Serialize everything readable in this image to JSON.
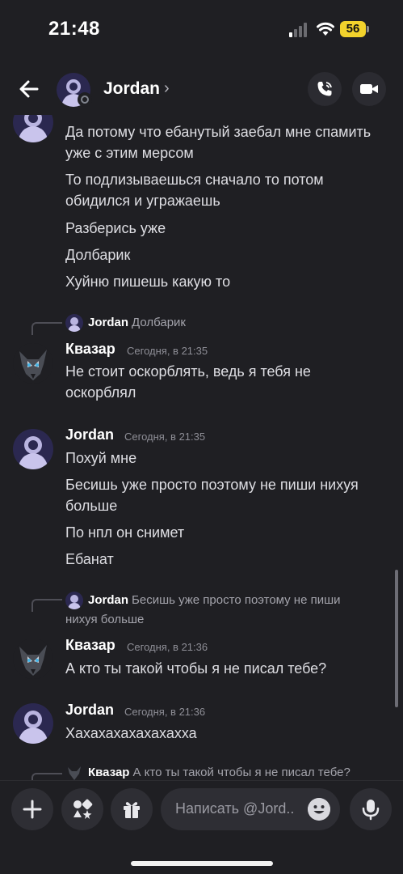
{
  "status_bar": {
    "time": "21:48",
    "battery": "56"
  },
  "header": {
    "name": "Jordan",
    "chevron": "›"
  },
  "messages": {
    "m1": {
      "lines": [
        "Да потому что ебанутый заебал мне спамить",
        "уже с этим мерсом",
        "То подлизываешься сначало то потом",
        "обидился и угражаешь",
        "Разберись уже",
        "Долбарик",
        "Хуйню пишешь какую то"
      ]
    },
    "m2": {
      "reply_name": "Jordan",
      "reply_text": "Долбарик",
      "author": "Квазар",
      "time": "Сегодня, в 21:35",
      "lines": [
        "Не стоит оскорблять, ведь я тебя не",
        "оскорблял"
      ]
    },
    "m3": {
      "author": "Jordan",
      "time": "Сегодня, в 21:35",
      "lines": [
        "Похуй мне",
        "Бесишь уже просто поэтому не пиши нихуя",
        "больше",
        "По нпл он снимет",
        "Ебанат"
      ]
    },
    "m4": {
      "reply_name": "Jordan",
      "reply_text_1": "Бесишь уже просто поэтому не пиши",
      "reply_text_2": "нихуя больше",
      "author": "Квазар",
      "time": "Сегодня, в 21:36",
      "lines": [
        "А кто ты такой чтобы я не писал тебе?"
      ]
    },
    "m5": {
      "author": "Jordan",
      "time": "Сегодня, в 21:36",
      "lines": [
        "Хахахахахахахахха"
      ]
    },
    "m6": {
      "reply_name": "Квазар",
      "reply_text": "А кто ты такой чтобы я не писал тебе?"
    }
  },
  "composer": {
    "placeholder": "Написать @Jord.."
  }
}
